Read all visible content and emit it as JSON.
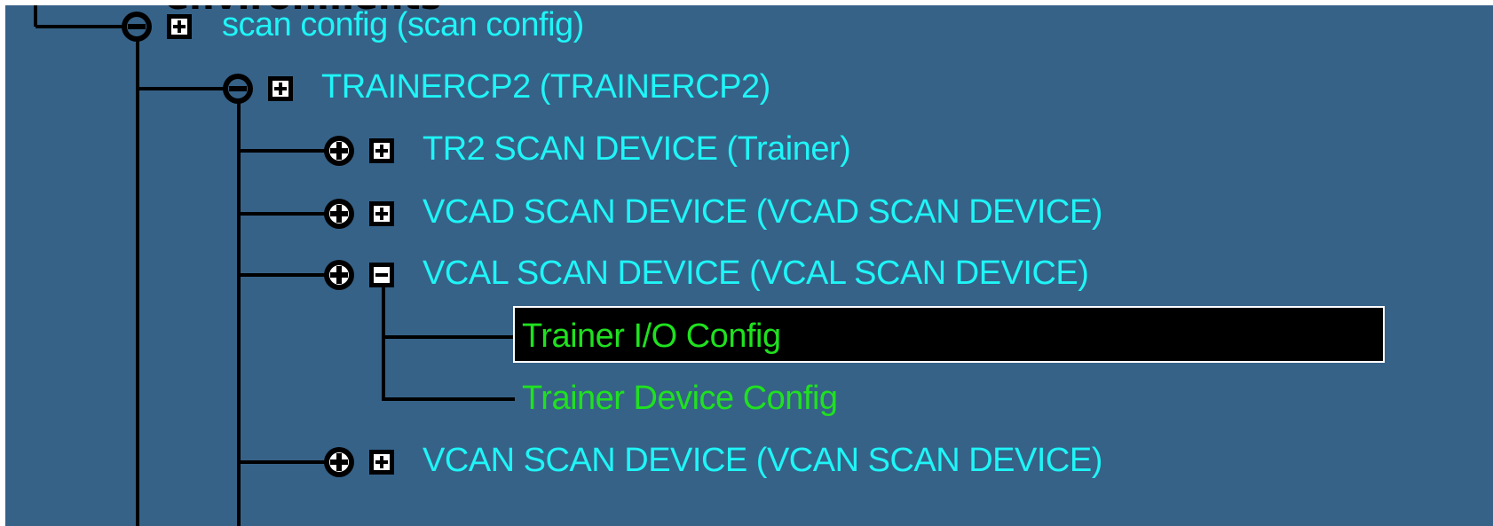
{
  "tree": {
    "partial_top_text": "environments",
    "nodes": [
      {
        "label": "scan config (scan config)",
        "expanded": true,
        "checkbox": "plus",
        "depth": 1
      },
      {
        "label": "TRAINERCP2 (TRAINERCP2)",
        "expanded": true,
        "checkbox": "plus",
        "depth": 2
      },
      {
        "label": "TR2 SCAN DEVICE (Trainer)",
        "expanded": false,
        "checkbox": "plus",
        "depth": 3
      },
      {
        "label": "VCAD SCAN DEVICE (VCAD SCAN DEVICE)",
        "expanded": false,
        "checkbox": "plus",
        "depth": 3
      },
      {
        "label": "VCAL SCAN DEVICE (VCAL SCAN DEVICE)",
        "expanded": false,
        "checkbox": "minus",
        "depth": 3
      },
      {
        "label": "Trainer I/O Config",
        "leaf": true,
        "selected": true,
        "depth": 4
      },
      {
        "label": "Trainer Device Config",
        "leaf": true,
        "selected": false,
        "depth": 4
      },
      {
        "label": "VCAN SCAN DEVICE (VCAN SCAN DEVICE)",
        "expanded": false,
        "checkbox": "plus",
        "depth": 3
      }
    ]
  },
  "colors": {
    "background": "#366288",
    "node_text": "#1ff5f7",
    "leaf_text": "#1fe11f",
    "selection_background": "#000000",
    "selection_border": "#ffffff",
    "connector_lines": "#000000"
  },
  "icons": {
    "expanded": "collapse-circle-icon",
    "collapsed": "expand-circle-icon",
    "checkbox_plus": "checkbox-plus-icon",
    "checkbox_minus": "checkbox-minus-icon"
  }
}
